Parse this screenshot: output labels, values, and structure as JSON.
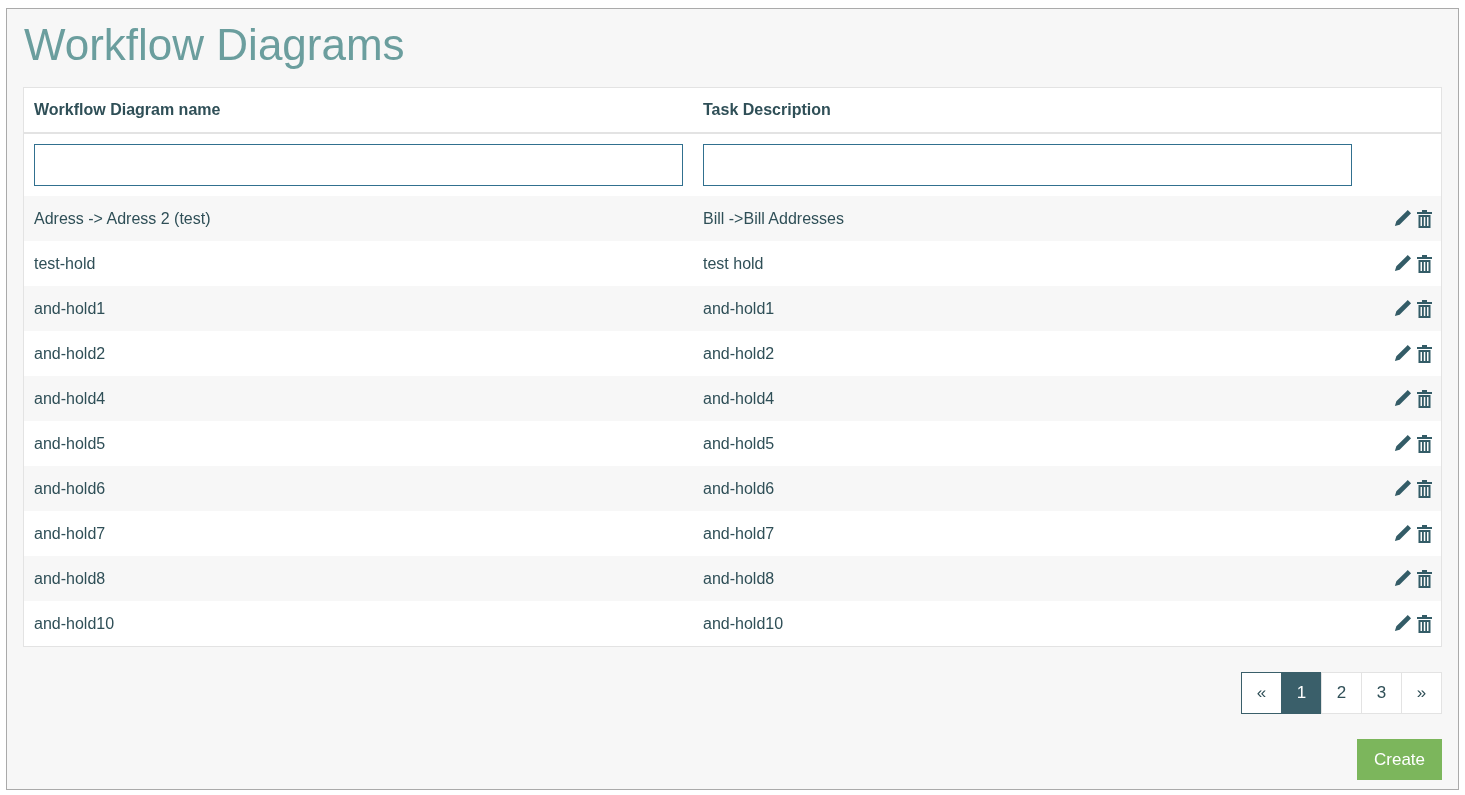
{
  "title": "Workflow Diagrams",
  "table": {
    "columns": [
      {
        "label": "Workflow Diagram name",
        "filter": true
      },
      {
        "label": "Task Description",
        "filter": true
      }
    ],
    "rows": [
      {
        "name": "Adress -> Adress 2 (test)",
        "description": "Bill ->Bill Addresses"
      },
      {
        "name": "test-hold",
        "description": "test hold"
      },
      {
        "name": "and-hold1",
        "description": "and-hold1"
      },
      {
        "name": "and-hold2",
        "description": "and-hold2"
      },
      {
        "name": "and-hold4",
        "description": "and-hold4"
      },
      {
        "name": "and-hold5",
        "description": "and-hold5"
      },
      {
        "name": "and-hold6",
        "description": "and-hold6"
      },
      {
        "name": "and-hold7",
        "description": "and-hold7"
      },
      {
        "name": "and-hold8",
        "description": "and-hold8"
      },
      {
        "name": "and-hold10",
        "description": "and-hold10"
      }
    ]
  },
  "pagination": [
    {
      "label": "«",
      "selected": false
    },
    {
      "label": "1",
      "selected": true
    },
    {
      "label": "2",
      "selected": false
    },
    {
      "label": "3",
      "selected": false
    },
    {
      "label": "»",
      "selected": false
    }
  ],
  "create_button": "Create"
}
